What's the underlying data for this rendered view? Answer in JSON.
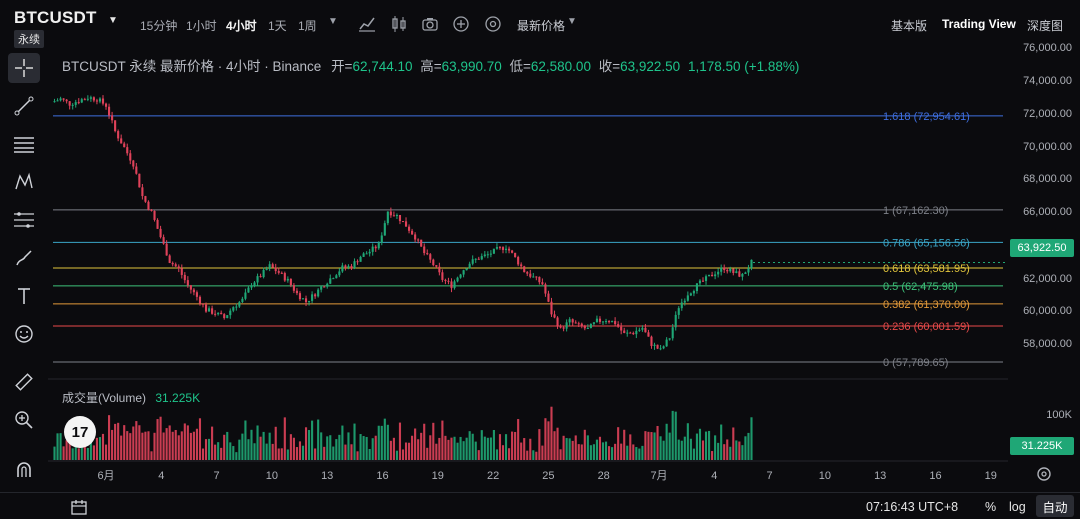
{
  "header": {
    "symbol": "BTCUSDT",
    "contract_badge": "永续",
    "timeframes": [
      {
        "label": "15分钟",
        "active": false
      },
      {
        "label": "1小时",
        "active": false
      },
      {
        "label": "4小时",
        "active": true
      },
      {
        "label": "1天",
        "active": false
      },
      {
        "label": "1周",
        "active": false
      }
    ],
    "price_type_label": "最新价格",
    "views": [
      {
        "label": "基本版",
        "active": false
      },
      {
        "label": "Trading View",
        "active": true
      },
      {
        "label": "深度图",
        "active": false
      }
    ]
  },
  "legend": {
    "title": "BTCUSDT 永续 最新价格 · 4小时 · Binance",
    "open_key": "开=",
    "open": "62,744.10",
    "high_key": "高=",
    "high": "63,990.70",
    "low_key": "低=",
    "low": "62,580.00",
    "close_key": "收=",
    "close": "63,922.50",
    "change": "1,178.50 (+1.88%)"
  },
  "volume_legend": {
    "label": "成交量(Volume)",
    "value": "31.225K"
  },
  "tv_logo_text": "17",
  "price_axis": {
    "ticks": [
      "76,000.00",
      "74,000.00",
      "72,000.00",
      "70,000.00",
      "68,000.00",
      "66,000.00",
      "62,000.00",
      "60,000.00",
      "58,000.00"
    ],
    "last_price": "63,922.50",
    "last_price_color": "#1fa776",
    "volume_tick": "100K",
    "volume_last": "31.225K"
  },
  "fib_levels": [
    {
      "label": "1.618 (72,954.61)",
      "price": 72954.61,
      "color": "#3f6fe0"
    },
    {
      "label": "1 (67,162.30)",
      "price": 67162.3,
      "color": "#7e8189"
    },
    {
      "label": "0.786 (65,156.56)",
      "price": 65156.56,
      "color": "#3aa6c8"
    },
    {
      "label": "0.618 (63,581.95)",
      "price": 63581.95,
      "color": "#e1c53c"
    },
    {
      "label": "0.5 (62,475.98)",
      "price": 62475.98,
      "color": "#3ec27a"
    },
    {
      "label": "0.382 (61,370.00)",
      "price": 61370.0,
      "color": "#e39a3a"
    },
    {
      "label": "0.236 (60,001.59)",
      "price": 60001.59,
      "color": "#e84a4a"
    },
    {
      "label": "0 (57,789.65)",
      "price": 57789.65,
      "color": "#7e8189"
    }
  ],
  "time_axis": [
    "6月",
    "4",
    "7",
    "10",
    "13",
    "16",
    "19",
    "22",
    "25",
    "28",
    "7月",
    "4",
    "7",
    "10",
    "13",
    "16",
    "19"
  ],
  "colors": {
    "up": "#1fa776",
    "down": "#e0425a",
    "background": "#0b0b0e"
  },
  "chart_data": {
    "type": "candlestick",
    "title": "BTCUSDT 永续 最新价格 · 4小时 · Binance",
    "ylim": [
      56800,
      76400
    ],
    "price_path": [
      73800,
      74000,
      73700,
      73900,
      74100,
      74000,
      73600,
      72000,
      71000,
      70000,
      68000,
      67000,
      65500,
      64000,
      63500,
      62500,
      61800,
      61000,
      60800,
      60500,
      61200,
      61600,
      62600,
      63100,
      63700,
      63300,
      62800,
      62000,
      61500,
      62000,
      62600,
      63100,
      63600,
      63700,
      64300,
      64600,
      65000,
      67100,
      66800,
      66200,
      65500,
      64500,
      63800,
      62900,
      62500,
      63300,
      63900,
      64200,
      64400,
      64700,
      64900,
      64200,
      63400,
      63000,
      62600,
      60800,
      59800,
      60300,
      60000,
      59800,
      60300,
      60400,
      60200,
      59500,
      59600,
      59900,
      58900,
      58500,
      59300,
      61200,
      62000,
      62500,
      62900,
      63300,
      63600,
      63300,
      63100,
      63922
    ],
    "volume_legend_value": "31.225K"
  },
  "bottom_bar": {
    "clock": "07:16:43 UTC+8",
    "percent_label": "%",
    "log_label": "log",
    "auto_label": "自动"
  }
}
